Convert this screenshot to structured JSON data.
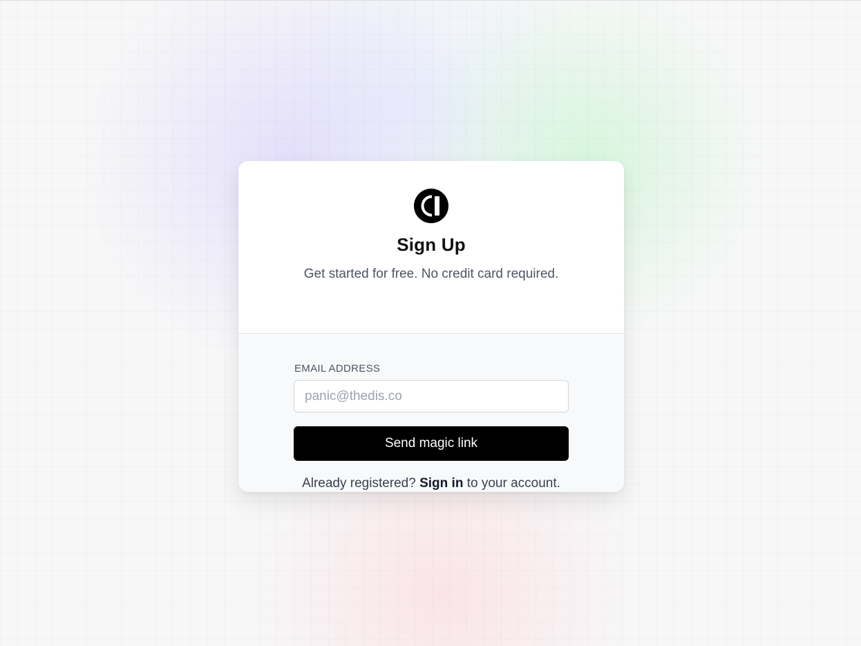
{
  "page": {
    "background_color": "#f7f7f8"
  },
  "card": {
    "logo_icon": "brand-logo-icon",
    "title": "Sign Up",
    "subtitle": "Get started for free. No credit card required."
  },
  "form": {
    "email_label": "EMAIL ADDRESS",
    "email_value": "",
    "email_placeholder": "panic@thedis.co",
    "submit_label": "Send magic link",
    "submit_color": "#000000"
  },
  "footer": {
    "prefix": "Already registered?",
    "link_label": "Sign in",
    "suffix": "to your account."
  }
}
